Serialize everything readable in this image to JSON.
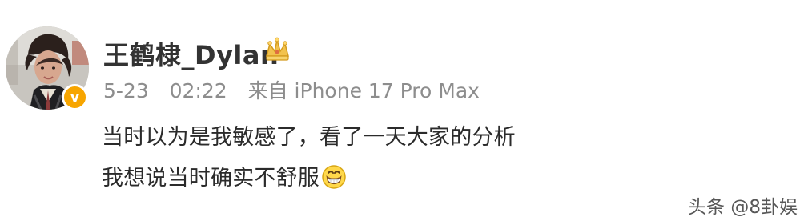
{
  "post": {
    "username": "王鹤棣_Dylan",
    "date": "5-23",
    "time": "02:22",
    "source": "来自 iPhone 17 Pro Max",
    "content_line_1": "当时以为是我敏感了，看了一天大家的分析",
    "content_line_2": "我想说当时确实不舒服",
    "badge_letter": "v"
  },
  "icons": {
    "verified_badge": "verified-v-icon",
    "crown": "crown-icon",
    "emoji": "grin-emoji-icon"
  },
  "watermark": {
    "text": "头条 @8卦娱"
  },
  "colors": {
    "username": "#333333",
    "meta": "#8d8d8d",
    "badge": "#f7a500",
    "crown": "#e7b23d",
    "text": "#2b2b2b"
  }
}
